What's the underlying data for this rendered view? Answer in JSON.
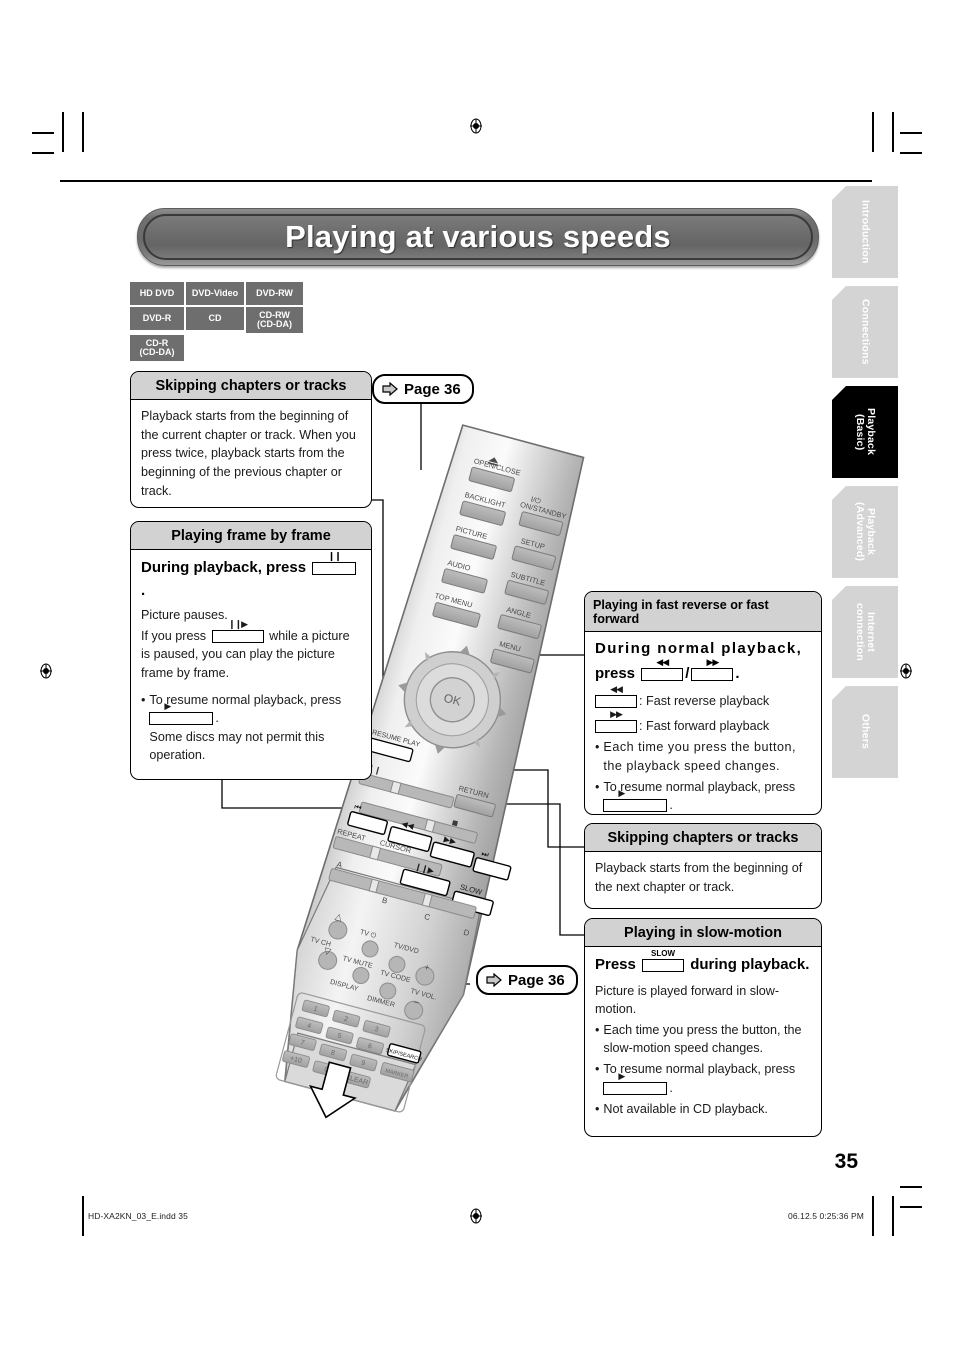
{
  "document": {
    "title": "Playing at various speeds",
    "page_number": "35",
    "footer_left": "HD-XA2KN_03_E.indd   35",
    "footer_right": "06.12.5   0:25:36 PM"
  },
  "disc_badges": [
    [
      "HD DVD",
      "DVD-Video",
      "DVD-RW"
    ],
    [
      "DVD-R",
      "CD",
      "CD-RW\n(CD-DA)"
    ],
    [
      "CD-R\n(CD-DA)"
    ]
  ],
  "disc_badges_flat": {
    "hd_dvd": "HD DVD",
    "dvd_video": "DVD-Video",
    "dvd_rw": "DVD-RW",
    "dvd_r": "DVD-R",
    "cd": "CD",
    "cd_rw": "CD-RW",
    "cd_rw_sub": "(CD-DA)",
    "cd_r": "CD-R",
    "cd_r_sub": "(CD-DA)"
  },
  "page_refs": {
    "top": "Page 36",
    "bottom": "Page 36"
  },
  "boxes": {
    "skip_prev": {
      "heading": "Skipping chapters or tracks",
      "body": "Playback starts from the beginning of the current chapter or track. When you press twice, playback starts from the beginning of the previous chapter or track."
    },
    "frame_by_frame": {
      "heading": "Playing frame by frame",
      "lead_before": "During playback, press",
      "lead_after": ".",
      "line1": "Picture pauses.",
      "line2_before": "If you press",
      "line2_after": "while a picture is paused, you can play the picture frame by frame.",
      "bullet1_before": "To resume normal playback, press",
      "bullet1_after": ".",
      "bullet1_extra": "Some discs may not permit this operation."
    },
    "fast_rev_fwd": {
      "heading": "Playing in fast reverse or fast forward",
      "lead_before": "During normal playback,",
      "lead_mid": "press",
      "lead_slash": "/",
      "lead_after": ".",
      "legend_rev": ": Fast reverse playback",
      "legend_fwd": ": Fast forward playback",
      "bullet1": "Each time you press the button, the playback speed changes.",
      "bullet2_before": "To resume normal playback, press",
      "bullet2_after": "."
    },
    "skip_next": {
      "heading": "Skipping chapters or tracks",
      "body": "Playback starts from the beginning of the next chapter or track."
    },
    "slow_motion": {
      "heading": "Playing in slow-motion",
      "lead_before": "Press",
      "lead_after": "during playback.",
      "line1": "Picture is played forward in slow-motion.",
      "bullet1": "Each time you press the button, the slow-motion speed changes.",
      "bullet2_before": "To resume normal playback, press",
      "bullet2_after": ".",
      "bullet3": "Not available in CD playback."
    }
  },
  "key_glyphs": {
    "pause": "❙❙",
    "step": "❙❙▶",
    "play": "▶",
    "fast_rev": "◀◀",
    "fast_fwd": "▶▶",
    "slow": "SLOW"
  },
  "sidebar_tabs": [
    {
      "label": "Introduction",
      "active": false
    },
    {
      "label": "Connections",
      "active": false
    },
    {
      "label": "Playback\n(Basic)",
      "active": true
    },
    {
      "label": "Playback\n(Advanced)",
      "active": false
    },
    {
      "label": "Internet\nconnection",
      "active": false
    },
    {
      "label": "Others",
      "active": false
    }
  ],
  "sidebar_tabs_text": {
    "t0": "Introduction",
    "t1": "Connections",
    "t2a": "Playback",
    "t2b": "(Basic)",
    "t3a": "Playback",
    "t3b": "(Advanced)",
    "t4a": "Internet",
    "t4b": "connection",
    "t5": "Others"
  },
  "remote": {
    "buttons_left": [
      "OPEN/CLOSE",
      "BACKLIGHT",
      "PICTURE",
      "AUDIO",
      "TOP MENU"
    ],
    "buttons_right": [
      "I/⏻ ON/STANDBY",
      "SETUP",
      "SUBTITLE",
      "ANGLE",
      "MENU"
    ],
    "center": "OK",
    "resume": "RESUME PLAY",
    "return": "RETURN",
    "repeat": "REPEAT",
    "cursor": "CURSOR",
    "slow": "SLOW",
    "color_keys": [
      "A",
      "B",
      "C",
      "D"
    ],
    "tv_labels": [
      "TV CH",
      "TV ⏻",
      "TV/DVD",
      "TV MUTE",
      "TV CODE",
      "DISPLAY",
      "DIMMER",
      "TV VOL."
    ],
    "keypad": [
      "1",
      "2",
      "3",
      "4",
      "5",
      "6",
      "7",
      "8",
      "9",
      "+10",
      "0",
      "CLEAR"
    ],
    "side_keys": [
      "SKIP/SEARCH",
      "MARKER"
    ]
  }
}
